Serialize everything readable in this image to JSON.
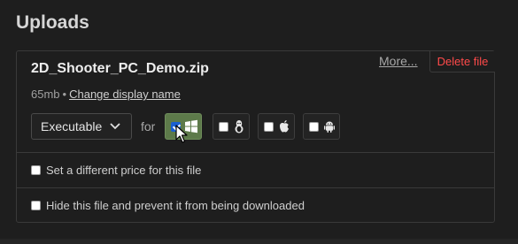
{
  "section": {
    "title": "Uploads"
  },
  "upload": {
    "file_name": "2D_Shooter_PC_Demo.zip",
    "size": "65mb",
    "separator": "•",
    "change_name_label": "Change display name",
    "more_label": "More...",
    "delete_label": "Delete file",
    "type_select": {
      "selected": "Executable"
    },
    "for_label": "for",
    "platforms": [
      {
        "name": "Windows",
        "icon": "windows-icon",
        "checked": true
      },
      {
        "name": "Linux",
        "icon": "linux-icon",
        "checked": false
      },
      {
        "name": "macOS",
        "icon": "apple-icon",
        "checked": false
      },
      {
        "name": "Android",
        "icon": "android-icon",
        "checked": false
      }
    ],
    "options": [
      {
        "label": "Set a different price for this file",
        "checked": false
      },
      {
        "label": "Hide this file and prevent it from being downloaded",
        "checked": false
      }
    ]
  },
  "colors": {
    "background": "#1e1e1e",
    "delete": "#ff4a4a",
    "active_platform": "#5d7a4a",
    "checkbox_checked": "#1a5fd0"
  }
}
